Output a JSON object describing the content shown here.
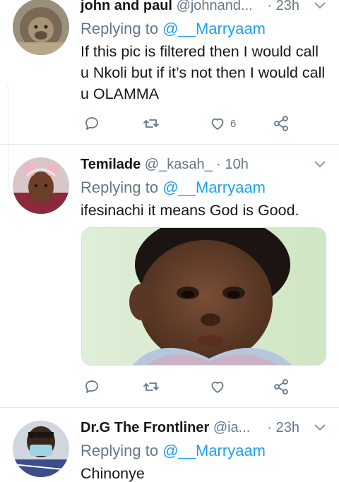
{
  "tweets": [
    {
      "name": "john and paul",
      "handle": "@johnand...",
      "time": "· 23h",
      "replying_prefix": "Replying to ",
      "replying_to": "@__Marryaam",
      "text": "If this pic is filtered then I would call u Nkoli but if it’s not then I would call u OLAMMA",
      "like_count": "6"
    },
    {
      "name": "Temilade",
      "handle": "@_kasah_",
      "time": "· 10h",
      "replying_prefix": "Replying to ",
      "replying_to": "@__Marryaam",
      "text": "ifesinachi it means God is Good.",
      "like_count": ""
    },
    {
      "name": "Dr.G The Frontliner",
      "handle": "@ia...",
      "time": "· 23h",
      "replying_prefix": "Replying to ",
      "replying_to": "@__Marryaam",
      "text": "Chinonye"
    }
  ],
  "icons": {
    "reply": "reply-icon",
    "retweet": "retweet-icon",
    "like": "heart-icon",
    "share": "share-icon",
    "more": "chevron-down-icon"
  },
  "colors": {
    "accent": "#1da1f2",
    "secondary_text": "#657786",
    "primary_text": "#14171a",
    "divider": "#e1e8ed"
  }
}
